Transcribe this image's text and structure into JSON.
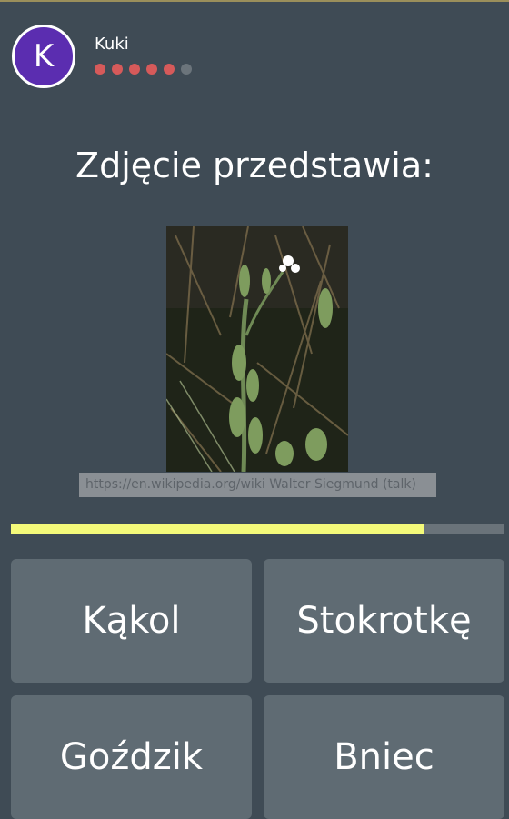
{
  "user": {
    "initial": "K",
    "name": "Kuki"
  },
  "lives": {
    "total": 6,
    "remaining": 5,
    "colors": {
      "active": "#d65a5a",
      "lost": "#6b747b"
    }
  },
  "question": {
    "text": "Zdjęcie przedstawia:"
  },
  "image": {
    "subject": "plant-photo",
    "credit": "https://en.wikipedia.org/wiki Walter Siegmund (talk)"
  },
  "timer": {
    "progress": 0.84,
    "color": "#f4fa7a"
  },
  "answers": [
    {
      "label": "Kąkol"
    },
    {
      "label": "Stokrotkę"
    },
    {
      "label": "Goździk"
    },
    {
      "label": "Bniec"
    }
  ]
}
